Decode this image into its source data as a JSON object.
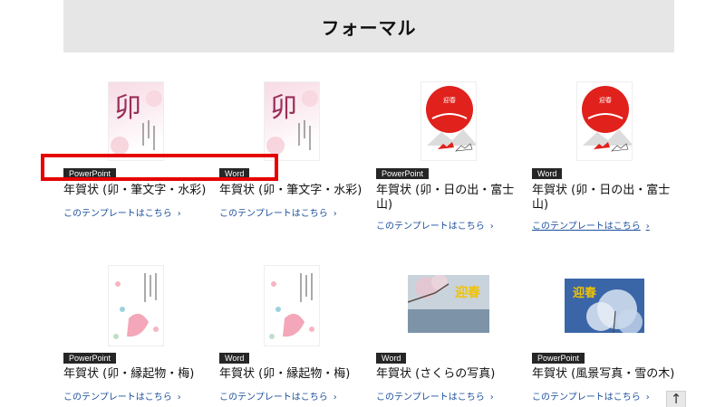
{
  "section_title": "フォーマル",
  "cards": [
    {
      "badge": "PowerPoint",
      "title": "年賀状 (卯・筆文字・水彩)",
      "link": "このテンプレートはこちら",
      "glyph": "卯"
    },
    {
      "badge": "Word",
      "title": "年賀状 (卯・筆文字・水彩)",
      "link": "このテンプレートはこちら",
      "glyph": "卯"
    },
    {
      "badge": "PowerPoint",
      "title": "年賀状 (卯・日の出・富士山)",
      "link": "このテンプレートはこちら",
      "sun_text": "迎春"
    },
    {
      "badge": "Word",
      "title": "年賀状 (卯・日の出・富士山)",
      "link": "このテンプレートはこちら",
      "sun_text": "迎春"
    },
    {
      "badge": "PowerPoint",
      "title": "年賀状 (卯・縁起物・梅)",
      "link": "このテンプレートはこちら"
    },
    {
      "badge": "Word",
      "title": "年賀状 (卯・縁起物・梅)",
      "link": "このテンプレートはこちら"
    },
    {
      "badge": "Word",
      "title": "年賀状 (さくらの写真)",
      "link": "このテンプレートはこちら",
      "photo_text": "迎春"
    },
    {
      "badge": "PowerPoint",
      "title": "年賀状 (風景写真・雪の木)",
      "link": "このテンプレートはこちら",
      "photo_text": "迎春"
    }
  ],
  "link_chevron": "›",
  "scroll_top_symbol": "↑",
  "colors": {
    "accent_link": "#1a4f9c",
    "badge_bg": "#262626",
    "highlight": "#e60000",
    "sun_red": "#e0211c"
  }
}
